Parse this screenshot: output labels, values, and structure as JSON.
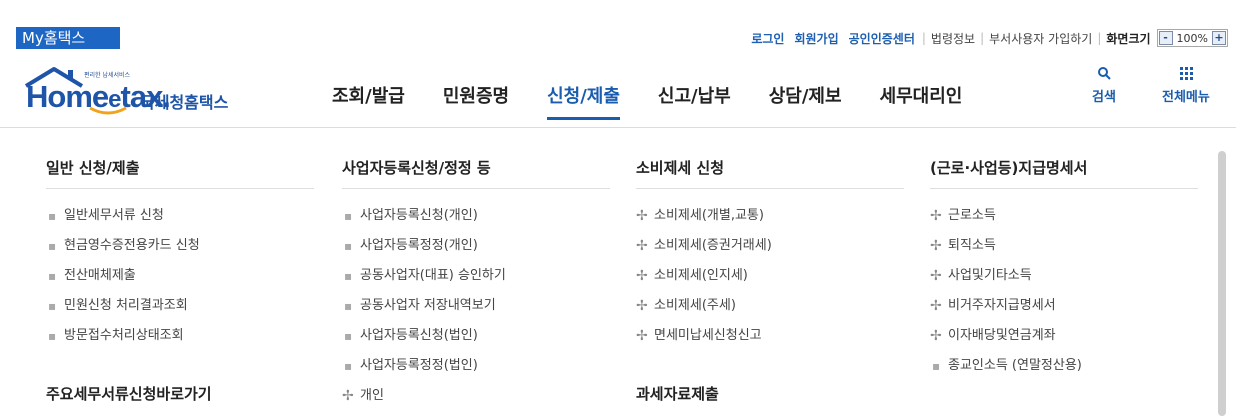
{
  "top": {
    "my_label": "My홈택스",
    "login": "로그인",
    "signup": "회원가입",
    "cert_center": "공인인증센터",
    "law_info": "법령정보",
    "dept_user": "부서사용자 가입하기",
    "screen_size": "화면크기",
    "zoom_minus": "-",
    "zoom_value": "100%",
    "zoom_plus": "+"
  },
  "logo": {
    "tiny_text": "편리한 납세서비스",
    "brand": "Home",
    "brand_e": "e",
    "brand_tail": "tax.",
    "korean": "국세청홈택스"
  },
  "nav": {
    "items": [
      "조회/발급",
      "민원증명",
      "신청/제출",
      "신고/납부",
      "상담/제보",
      "세무대리인"
    ],
    "active_index": 2,
    "search_label": "검색",
    "all_menu_label": "전체메뉴"
  },
  "panel": {
    "col1": {
      "title": "일반 신청/제출",
      "items": [
        "일반세무서류 신청",
        "현금영수증전용카드 신청",
        "전산매체제출",
        "민원신청 처리결과조회",
        "방문접수처리상태조회"
      ],
      "sub_title": "주요세무서류신청바로가기"
    },
    "col2": {
      "title": "사업자등록신청/정정 등",
      "items": [
        "사업자등록신청(개인)",
        "사업자등록정정(개인)",
        "공동사업자(대표) 승인하기",
        "공동사업자 저장내역보기",
        "사업자등록신청(법인)",
        "사업자등록정정(법인)"
      ],
      "sub_item": "개인"
    },
    "col3": {
      "title": "소비제세 신청",
      "items": [
        "소비제세(개별,교통)",
        "소비제세(증권거래세)",
        "소비제세(인지세)",
        "소비제세(주세)",
        "면세미납세신청신고"
      ],
      "sub_title": "과세자료제출"
    },
    "col4": {
      "title": "(근로·사업등)지급명세서",
      "items": [
        "근로소득",
        "퇴직소득",
        "사업및기타소득",
        "비거주자지급명세서",
        "이자배당및연금계좌"
      ],
      "last_item": "종교인소득 (연말정산용)"
    }
  },
  "colors": {
    "accent": "#1a5cae",
    "badge": "#1e66c4"
  }
}
